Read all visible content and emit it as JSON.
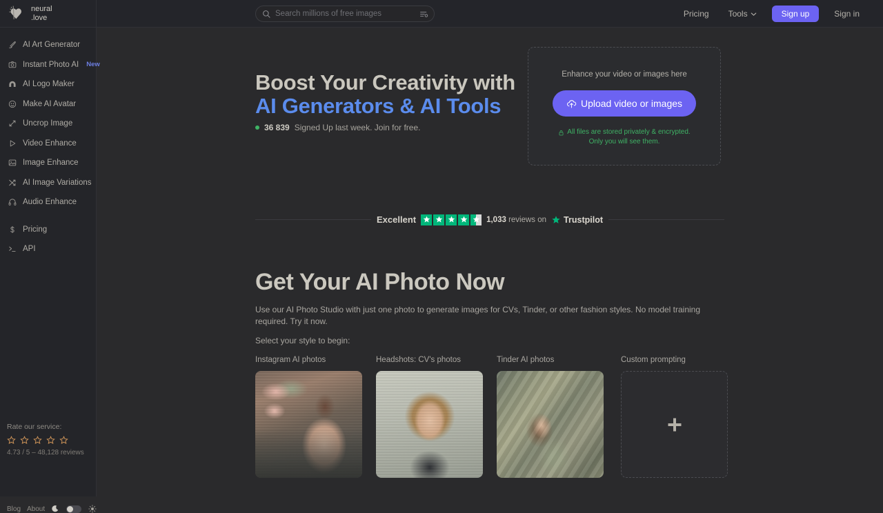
{
  "brand": {
    "line1": "neural",
    "line2": ".love",
    "logo_icon": "heart-logo-icon"
  },
  "search": {
    "placeholder": "Search millions of free images",
    "value": "",
    "search_icon": "search-icon",
    "filter_icon": "filter-settings-icon"
  },
  "topnav": {
    "pricing": "Pricing",
    "tools": "Tools",
    "tools_chevron_icon": "chevron-down-icon",
    "signup": "Sign up",
    "signin": "Sign in",
    "accent_color": "#6c63f2"
  },
  "sidebar": {
    "items": [
      {
        "label": "AI Art Generator",
        "icon": "brush-icon"
      },
      {
        "label": "Instant Photo AI",
        "icon": "camera-icon",
        "badge": "New"
      },
      {
        "label": "AI Logo Maker",
        "icon": "logo-arch-icon"
      },
      {
        "label": "Make AI Avatar",
        "icon": "avatar-face-icon"
      },
      {
        "label": "Uncrop Image",
        "icon": "expand-diagonal-icon"
      },
      {
        "label": "Video Enhance",
        "icon": "play-triangle-icon"
      },
      {
        "label": "Image Enhance",
        "icon": "image-icon"
      },
      {
        "label": "AI Image Variations",
        "icon": "shuffle-icon"
      },
      {
        "label": "Audio Enhance",
        "icon": "headphones-icon"
      }
    ],
    "items2": [
      {
        "label": "Pricing",
        "icon": "dollar-icon"
      },
      {
        "label": "API",
        "icon": "terminal-prompt-icon"
      }
    ],
    "rate": {
      "label": "Rate our service:",
      "stars": 5,
      "star_icon": "star-outline-icon",
      "star_color": "#d79a5b",
      "summary": "4.73 / 5 – 48,128 reviews"
    },
    "footer": {
      "blog": "Blog",
      "about": "About",
      "moon_icon": "moon-icon",
      "sun_icon": "sun-icon",
      "toggle_state": "dark"
    }
  },
  "hero": {
    "title_line1": "Boost Your Creativity with",
    "title_line2": "AI Generators & AI Tools",
    "title_line2_color": "#5b8ced",
    "signups_count": "36 839",
    "signups_text": "Signed Up last week. Join for free.",
    "status_dot_color": "#3fb365"
  },
  "upload": {
    "hint": "Enhance your video or images here",
    "button_label": "Upload video or images",
    "button_icon": "cloud-upload-icon",
    "note_line1": "All files are stored privately & encrypted.",
    "note_line2": "Only you will see them.",
    "note_icon": "lock-icon",
    "note_color": "#3fb365"
  },
  "trustpilot": {
    "rating_word": "Excellent",
    "stars_filled": 4,
    "stars_partial": 0.5,
    "stars_total": 5,
    "star_color": "#00b67a",
    "reviews_count": "1,033",
    "reviews_text": "reviews on",
    "brand": "Trustpilot",
    "brand_star_icon": "trustpilot-star-icon"
  },
  "photo_section": {
    "title": "Get Your AI Photo Now",
    "description": "Use our AI Photo Studio with just one photo to generate images for CVs, Tinder, or other fashion styles. No model training required. Try it now.",
    "select_prompt": "Select your style to begin:",
    "cards": [
      {
        "label": "Instagram AI photos",
        "kind": "photo",
        "art": "ph1"
      },
      {
        "label": "Headshots: CV's photos",
        "kind": "photo",
        "art": "ph2"
      },
      {
        "label": "Tinder AI photos",
        "kind": "photo",
        "art": "ph3"
      },
      {
        "label": "Custom prompting",
        "kind": "add",
        "icon": "plus-icon"
      }
    ]
  }
}
